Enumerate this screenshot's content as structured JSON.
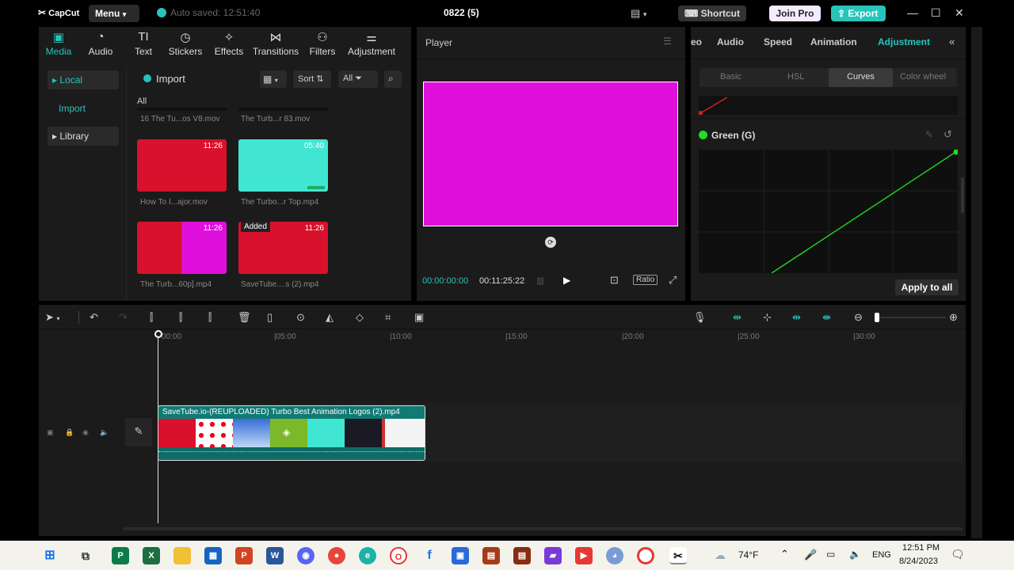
{
  "titlebar": {
    "logo": "CapCut",
    "menu_label": "Menu",
    "autosave": "Auto saved: 12:51:40",
    "project_title": "0822 (5)",
    "shortcut_label": "Shortcut",
    "joinpro_label": "Join Pro",
    "export_label": "Export"
  },
  "media": {
    "tabs": [
      {
        "label": "Media",
        "icon": "media-icon"
      },
      {
        "label": "Audio",
        "icon": "audio-icon"
      },
      {
        "label": "Text",
        "icon": "text-icon"
      },
      {
        "label": "Stickers",
        "icon": "stickers-icon"
      },
      {
        "label": "Effects",
        "icon": "effects-icon"
      },
      {
        "label": "Transitions",
        "icon": "transitions-icon"
      },
      {
        "label": "Filters",
        "icon": "filters-icon"
      },
      {
        "label": "Adjustment",
        "icon": "adjustment-icon"
      }
    ],
    "sidebar": {
      "local": "Local",
      "import": "Import",
      "library": "Library"
    },
    "import_button": "Import",
    "sort_label": "Sort",
    "all_filter": "All",
    "section_label": "All",
    "top_names": [
      "16 The Tu...os V8.mov",
      "The Turb...r 83.mov"
    ],
    "items": [
      {
        "name": "How To I...ajor.mov",
        "duration": "11:26",
        "added": ""
      },
      {
        "name": "The Turbo...r Top.mp4",
        "duration": "05:40",
        "added": ""
      },
      {
        "name": "The Turb...60p].mp4",
        "duration": "11:26",
        "added": ""
      },
      {
        "name": "SaveTube....s (2).mp4",
        "duration": "11:26",
        "added": "Added"
      }
    ]
  },
  "player": {
    "title": "Player",
    "current_time": "00:00:00:00",
    "total_time": "00:11:25:22",
    "ratio_label": "Ratio",
    "preview_color": "#e010dc"
  },
  "adjustment": {
    "tabs": [
      "eo",
      "Audio",
      "Speed",
      "Animation",
      "Adjustment"
    ],
    "subtabs": [
      "Basic",
      "HSL",
      "Curves",
      "Color wheel"
    ],
    "channel_label": "Green (G)",
    "apply_all": "Apply to all"
  },
  "timeline": {
    "ruler": [
      "00:00",
      "05:00",
      "10:00",
      "15:00",
      "20:00",
      "25:00",
      "30:00"
    ],
    "clip_name": "SaveTube.io-(REUPLOADED) Turbo Best Animation Logos (2).mp4"
  },
  "taskbar": {
    "weather": "74°F",
    "lang": "ENG",
    "time": "12:51 PM",
    "date": "8/24/2023"
  },
  "colors": {
    "accent": "#27c4b9",
    "magenta": "#e010dc",
    "red": "#d9112c",
    "cyan": "#40e6d2"
  }
}
